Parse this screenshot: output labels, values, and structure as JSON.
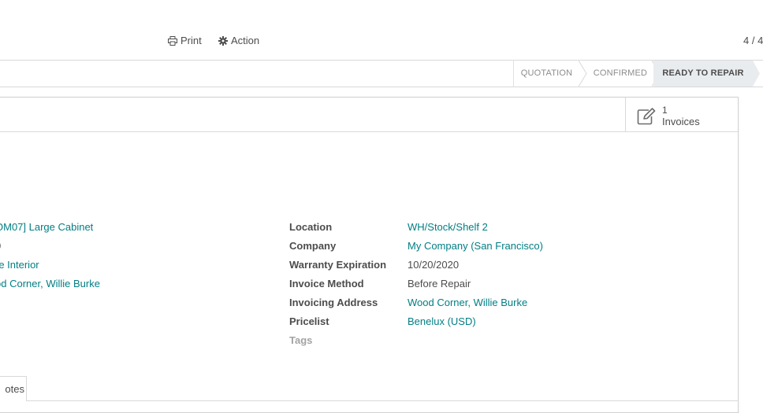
{
  "control_panel": {
    "print_label": "Print",
    "action_label": "Action",
    "pager_value": "4 / 4"
  },
  "statusbar": {
    "stages": [
      "QUOTATION",
      "CONFIRMED",
      "READY TO REPAIR"
    ],
    "current_stage": "READY TO REPAIR"
  },
  "smart_button": {
    "value": "1",
    "label": "Invoices",
    "icon": "pencil-square-icon"
  },
  "left_fields": {
    "product": "OM07] Large Cabinet",
    "quantity": "0",
    "customer": "re Interior",
    "address": "od Corner, Willie Burke"
  },
  "right_fields": {
    "location_label": "Location",
    "location_value": "WH/Stock/Shelf 2",
    "company_label": "Company",
    "company_value": "My Company (San Francisco)",
    "warranty_label": "Warranty Expiration",
    "warranty_value": "10/20/2020",
    "invoice_method_label": "Invoice Method",
    "invoice_method_value": "Before Repair",
    "invoicing_address_label": "Invoicing Address",
    "invoicing_address_value": "Wood Corner, Willie Burke",
    "pricelist_label": "Pricelist",
    "pricelist_value": "Benelux (USD)",
    "tags_label": "Tags"
  },
  "tabs": {
    "notes_label": "otes"
  },
  "colors": {
    "link": "#017e84",
    "text": "#4c4c4c",
    "muted": "#a3a3a3",
    "active_stage_bg": "#e9ecef"
  }
}
